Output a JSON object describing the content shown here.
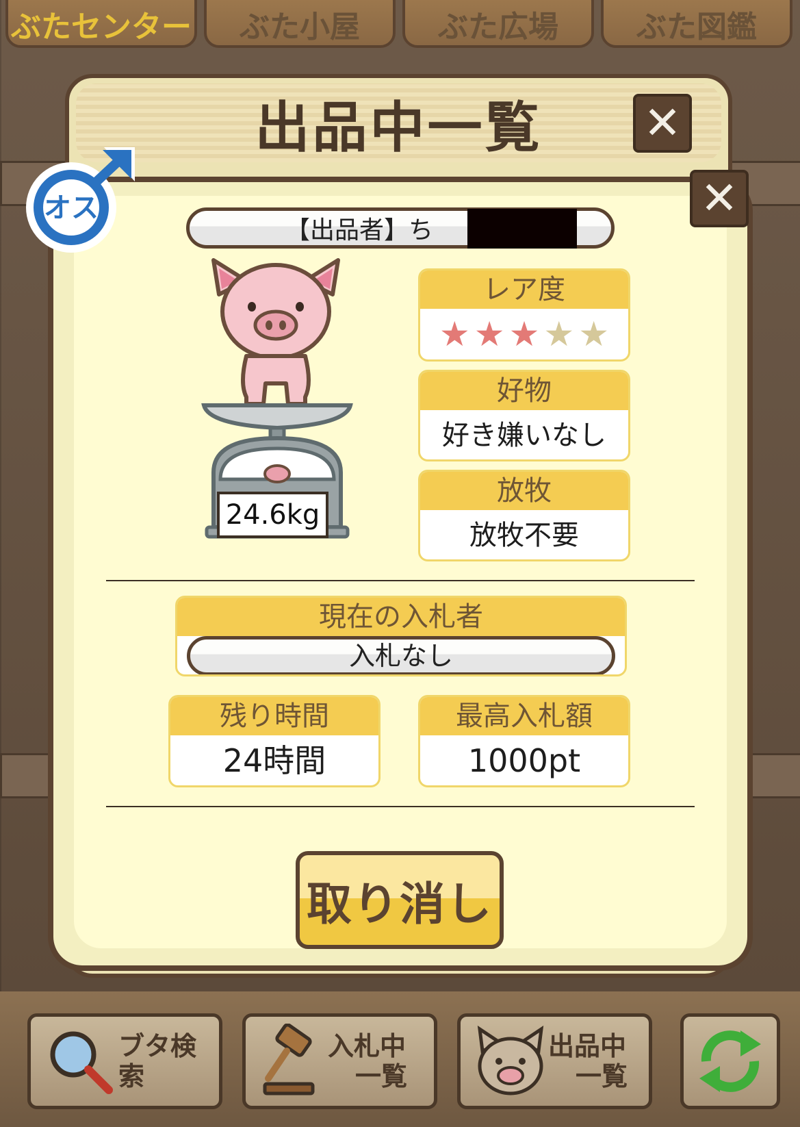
{
  "top_tabs": [
    {
      "label": "ぶたセンター"
    },
    {
      "label": "ぶた小屋"
    },
    {
      "label": "ぶた広場"
    },
    {
      "label": "ぶた図鑑"
    }
  ],
  "panel": {
    "title": "出品中一覧",
    "close_symbol": "✕"
  },
  "card": {
    "close_symbol": "✕",
    "gender_label": "オス",
    "seller_label": "【出品者】ち",
    "weight": "24.6kg",
    "rarity": {
      "label": "レア度",
      "stars_filled": 3,
      "stars_total": 5
    },
    "favorite": {
      "label": "好物",
      "value": "好き嫌いなし"
    },
    "grazing": {
      "label": "放牧",
      "value": "放牧不要"
    },
    "current_bidder": {
      "label": "現在の入札者",
      "value": "入札なし"
    },
    "time_left": {
      "label": "残り時間",
      "value": "24時間"
    },
    "highest_bid": {
      "label": "最高入札額",
      "value": "1000pt"
    },
    "cancel_label": "取り消し"
  },
  "bottom_nav": {
    "search_label": "ブタ検索",
    "bidding_line1": "入札中",
    "bidding_line2": "一覧",
    "listing_line1": "出品中",
    "listing_line2": "一覧"
  },
  "colors": {
    "accent_yellow": "#f4cc52",
    "brown": "#5b4330",
    "star_on": "#e37a76",
    "star_off": "#d5c89a"
  }
}
